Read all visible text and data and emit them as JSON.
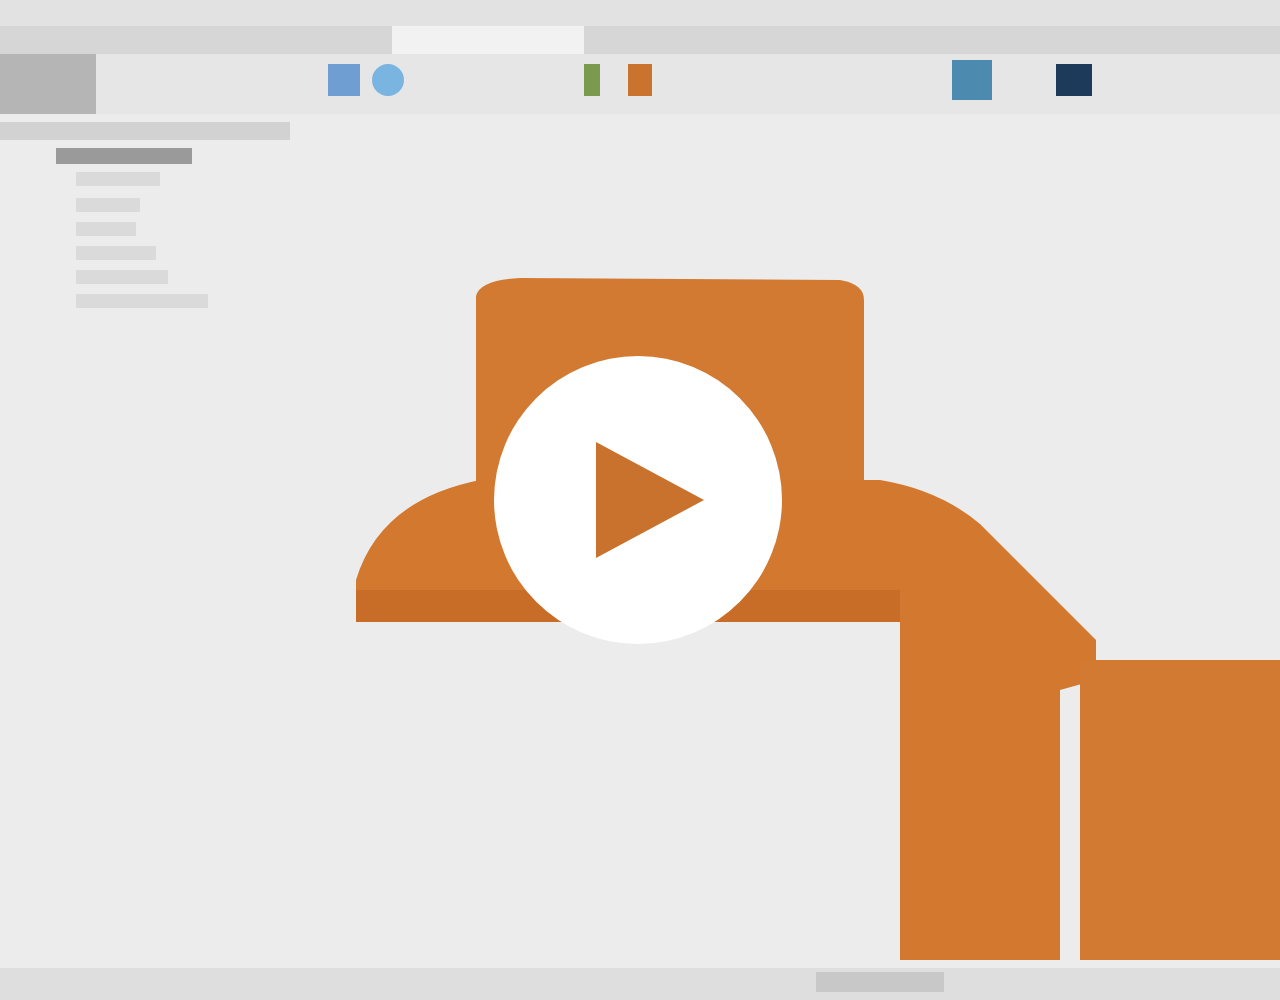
{
  "video_player": {
    "playing": false
  }
}
